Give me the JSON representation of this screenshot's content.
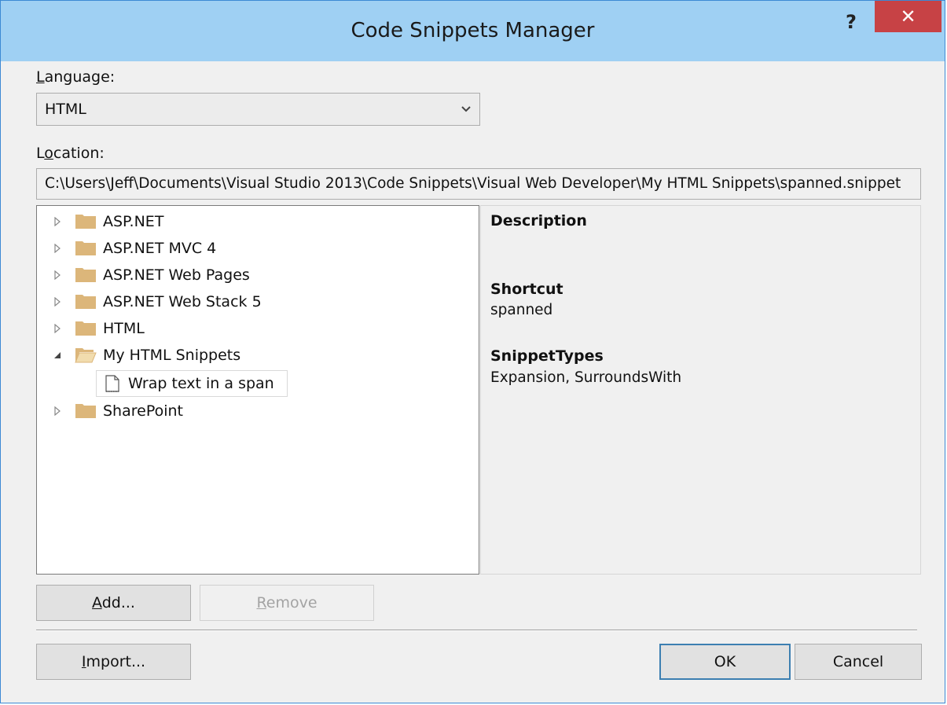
{
  "window": {
    "title": "Code Snippets Manager",
    "help": "?",
    "close": "✕"
  },
  "language": {
    "label_accel": "L",
    "label_rest": "anguage:",
    "selected": "HTML"
  },
  "location": {
    "label_pre": "L",
    "label_accel": "o",
    "label_rest": "cation:",
    "value": "C:\\Users\\Jeff\\Documents\\Visual Studio 2013\\Code Snippets\\Visual Web Developer\\My HTML Snippets\\spanned.snippet"
  },
  "tree": {
    "items": [
      {
        "label": "ASP.NET",
        "expanded": false
      },
      {
        "label": "ASP.NET MVC 4",
        "expanded": false
      },
      {
        "label": "ASP.NET Web Pages",
        "expanded": false
      },
      {
        "label": "ASP.NET Web Stack 5",
        "expanded": false
      },
      {
        "label": "HTML",
        "expanded": false
      },
      {
        "label": "My HTML Snippets",
        "expanded": true,
        "children": [
          {
            "label": "Wrap text in a span"
          }
        ]
      },
      {
        "label": "SharePoint",
        "expanded": false
      }
    ]
  },
  "details": {
    "description_heading": "Description",
    "description_value": "",
    "shortcut_heading": "Shortcut",
    "shortcut_value": "spanned",
    "types_heading": "SnippetTypes",
    "types_value": "Expansion, SurroundsWith"
  },
  "buttons": {
    "add_accel": "A",
    "add_rest": "dd...",
    "remove_accel": "R",
    "remove_rest": "emove",
    "import_accel": "I",
    "import_rest": "mport...",
    "ok": "OK",
    "cancel": "Cancel"
  },
  "colors": {
    "title_bar": "#9fd0f3",
    "close_button": "#c74245",
    "folder": "#dcb67a"
  }
}
